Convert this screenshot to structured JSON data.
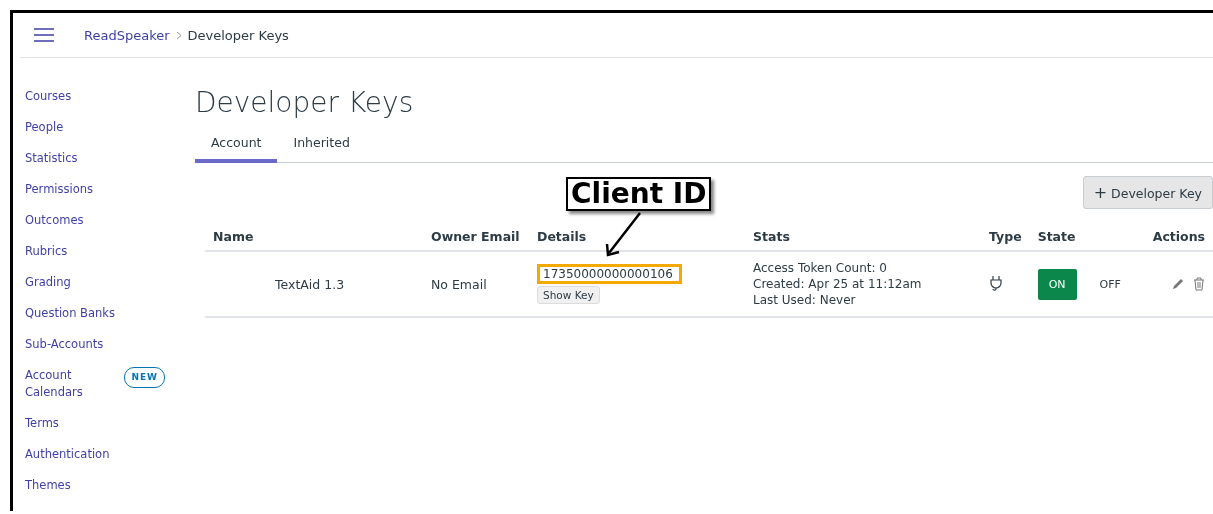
{
  "breadcrumb": [
    {
      "label": "ReadSpeaker",
      "kind": "link"
    },
    {
      "label": "Developer Keys",
      "kind": "current"
    }
  ],
  "sidebar": {
    "items": [
      {
        "label": "Courses"
      },
      {
        "label": "People"
      },
      {
        "label": "Statistics"
      },
      {
        "label": "Permissions"
      },
      {
        "label": "Outcomes"
      },
      {
        "label": "Rubrics"
      },
      {
        "label": "Grading"
      },
      {
        "label": "Question Banks"
      },
      {
        "label": "Sub-Accounts"
      },
      {
        "label": "Account Calendars",
        "badge": "NEW"
      },
      {
        "label": "Terms"
      },
      {
        "label": "Authentication"
      },
      {
        "label": "Themes"
      }
    ]
  },
  "page_title": "Developer Keys",
  "tabs": [
    {
      "label": "Account",
      "selected": true
    },
    {
      "label": "Inherited",
      "selected": false
    }
  ],
  "add_button": {
    "icon": "+",
    "label": "Developer Key"
  },
  "table": {
    "columns": [
      "Name",
      "Owner Email",
      "Details",
      "Stats",
      "Type",
      "State",
      "Actions"
    ],
    "rows": [
      {
        "name": "TextAid 1.3",
        "owner_email": "No Email",
        "client_id": "17350000000000106",
        "show_key": "Show Key",
        "stats": [
          "Access Token Count: 0",
          "Created: Apr 25 at 11:12am",
          "Last Used: Never"
        ],
        "state_on": "ON",
        "state_off": "OFF",
        "on": true
      }
    ]
  },
  "annotation": {
    "label": "Client ID"
  }
}
